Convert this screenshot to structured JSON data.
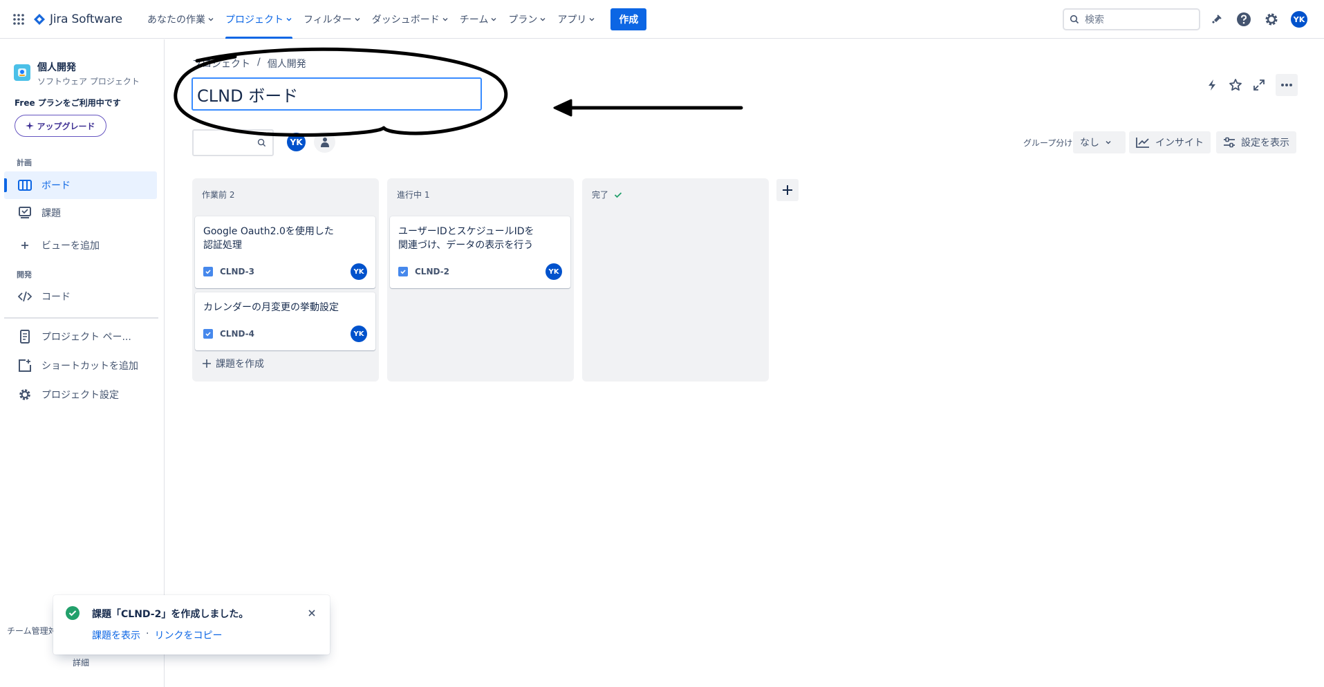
{
  "topnav": {
    "product": "Jira Software",
    "items": [
      {
        "label": "あなたの作業",
        "active": false
      },
      {
        "label": "プロジェクト",
        "active": true
      },
      {
        "label": "フィルター",
        "active": false
      },
      {
        "label": "ダッシュボード",
        "active": false
      },
      {
        "label": "チーム",
        "active": false
      },
      {
        "label": "プラン",
        "active": false
      },
      {
        "label": "アプリ",
        "active": false
      }
    ],
    "create_label": "作成",
    "search_placeholder": "検索",
    "user_initials": "YK",
    "icons": [
      "apps-grid-icon",
      "notification-icon",
      "help-icon",
      "settings-icon"
    ]
  },
  "sidebar": {
    "project_name": "個人開発",
    "project_type": "ソフトウェア プロジェクト",
    "free_plan_text": "Free プランをご利用中です",
    "upgrade_label": "アップグレード",
    "section_plan": "計画",
    "section_dev": "開発",
    "items": {
      "board": "ボード",
      "issues": "課題",
      "add_view": "ビューを追加",
      "code": "コード",
      "project_pages": "プロジェクト ペー...",
      "add_shortcut": "ショートカットを追加",
      "project_settings": "プロジェクト設定"
    },
    "team_text": "チーム管理対",
    "detail_text": "詳細"
  },
  "main": {
    "breadcrumb": [
      "プロジェクト",
      "/",
      "個人開発"
    ],
    "board_title": "CLND ボード",
    "filter_avatar": "YK",
    "group_by_label": "グループ分け",
    "group_by_value": "なし",
    "insights_label": "インサイト",
    "view_settings_label": "設定を表示",
    "columns": [
      {
        "name": "作業前 2",
        "cards": [
          {
            "title": "Google Oauth2.0を使用した認証処理",
            "key": "CLND-3",
            "assignee": "YK"
          },
          {
            "title": "カレンダーの月変更の挙動設定",
            "key": "CLND-4",
            "assignee": "YK"
          }
        ],
        "create_label": "課題を作成"
      },
      {
        "name": "進行中 1",
        "cards": [
          {
            "title": "ユーザーIDとスケジュールIDを関連づけ、データの表示を行う",
            "key": "CLND-2",
            "assignee": "YK"
          }
        ]
      },
      {
        "name": "完了",
        "cards": []
      }
    ]
  },
  "toast": {
    "title": "課題「CLND-2」を作成しました。",
    "view_link": "課題を表示",
    "separator": "·",
    "copy_link": "リンクをコピー"
  },
  "colors": {
    "accent": "#0c66e4",
    "annotation": "#000000",
    "success": "#22a06b"
  }
}
